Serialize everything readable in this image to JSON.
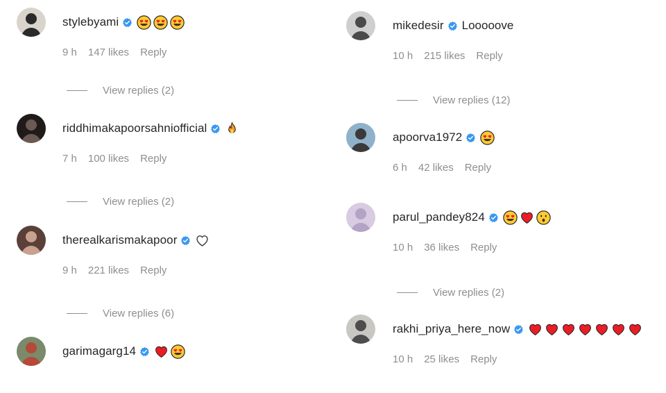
{
  "left_comments": [
    {
      "username": "stylebyami",
      "text": "",
      "emojis": [
        "heart-eyes",
        "heart-eyes",
        "heart-eyes"
      ],
      "time": "9 h",
      "likes": "147 likes",
      "reply": "Reply",
      "view_replies": "View replies (2)",
      "avatar": {
        "bg": "#d9d4cc",
        "fg": "#2a2a2a"
      }
    },
    {
      "username": "riddhimakapoorsahniofficial",
      "text": "",
      "emojis": [
        "fire"
      ],
      "time": "7 h",
      "likes": "100 likes",
      "reply": "Reply",
      "view_replies": "View replies (2)",
      "avatar": {
        "bg": "#1f1b1a",
        "fg": "#6b5a52"
      }
    },
    {
      "username": "therealkarismakapoor",
      "text": "",
      "emojis": [
        "white-heart"
      ],
      "time": "9 h",
      "likes": "221 likes",
      "reply": "Reply",
      "view_replies": "View replies (6)",
      "avatar": {
        "bg": "#5a4038",
        "fg": "#c9a190"
      }
    },
    {
      "username": "garimagarg14",
      "text": "",
      "emojis": [
        "red-heart",
        "heart-eyes"
      ],
      "time": "",
      "likes": "",
      "reply": "",
      "view_replies": "",
      "avatar": {
        "bg": "#7b8a6a",
        "fg": "#b44a3a"
      }
    }
  ],
  "right_comments": [
    {
      "username": "mikedesir",
      "text": "Looooove",
      "emojis": [],
      "time": "10 h",
      "likes": "215 likes",
      "reply": "Reply",
      "view_replies": "View replies (12)",
      "avatar": {
        "bg": "#cfcfcf",
        "fg": "#4a4a4a"
      }
    },
    {
      "username": "apoorva1972",
      "text": "",
      "emojis": [
        "heart-eyes"
      ],
      "time": "6 h",
      "likes": "42 likes",
      "reply": "Reply",
      "view_replies": "",
      "avatar": {
        "bg": "#8fb1c9",
        "fg": "#3a3a3a"
      }
    },
    {
      "username": "parul_pandey824",
      "text": "",
      "emojis": [
        "heart-eyes",
        "red-heart",
        "surprised"
      ],
      "time": "10 h",
      "likes": "36 likes",
      "reply": "Reply",
      "view_replies": "View replies (2)",
      "avatar": {
        "bg": "#d8cbe2",
        "fg": "#b3a3c4"
      }
    },
    {
      "username": "rakhi_priya_here_now",
      "text": "",
      "emojis": [
        "red-heart",
        "red-heart",
        "red-heart",
        "red-heart",
        "red-heart",
        "red-heart",
        "red-heart"
      ],
      "time": "10 h",
      "likes": "25 likes",
      "reply": "Reply",
      "view_replies": "",
      "avatar": {
        "bg": "#c9c7c2",
        "fg": "#4d4d4d"
      }
    }
  ],
  "colors": {
    "text": "#262626",
    "meta": "#8e8e8e",
    "verified": "#3897f0",
    "heart_red": "#ed1c24",
    "emoji_yellow": "#ffcc33"
  }
}
